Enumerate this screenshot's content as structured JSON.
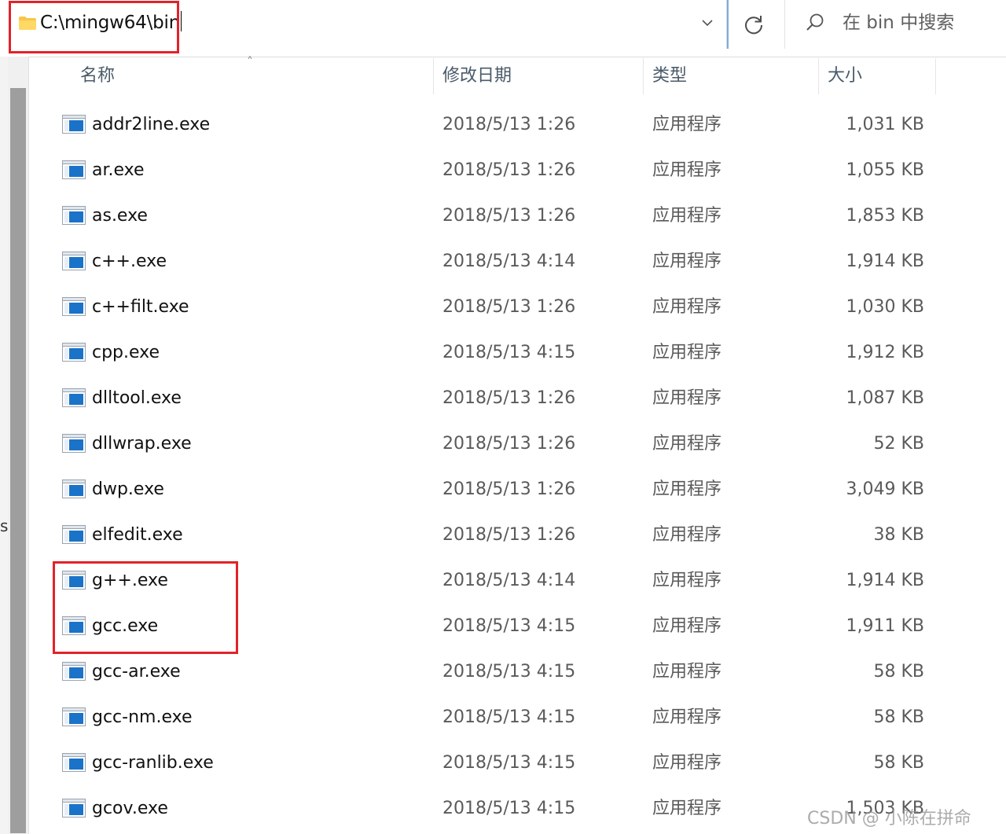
{
  "address_bar": {
    "path": "C:\\mingw64\\bin"
  },
  "search": {
    "placeholder": "在 bin 中搜索"
  },
  "columns": {
    "name": "名称",
    "modified": "修改日期",
    "type": "类型",
    "size": "大小"
  },
  "files": [
    {
      "name": "addr2line.exe",
      "modified": "2018/5/13 1:26",
      "type": "应用程序",
      "size": "1,031 KB"
    },
    {
      "name": "ar.exe",
      "modified": "2018/5/13 1:26",
      "type": "应用程序",
      "size": "1,055 KB"
    },
    {
      "name": "as.exe",
      "modified": "2018/5/13 1:26",
      "type": "应用程序",
      "size": "1,853 KB"
    },
    {
      "name": "c++.exe",
      "modified": "2018/5/13 4:14",
      "type": "应用程序",
      "size": "1,914 KB"
    },
    {
      "name": "c++filt.exe",
      "modified": "2018/5/13 1:26",
      "type": "应用程序",
      "size": "1,030 KB"
    },
    {
      "name": "cpp.exe",
      "modified": "2018/5/13 4:15",
      "type": "应用程序",
      "size": "1,912 KB"
    },
    {
      "name": "dlltool.exe",
      "modified": "2018/5/13 1:26",
      "type": "应用程序",
      "size": "1,087 KB"
    },
    {
      "name": "dllwrap.exe",
      "modified": "2018/5/13 1:26",
      "type": "应用程序",
      "size": "52 KB"
    },
    {
      "name": "dwp.exe",
      "modified": "2018/5/13 1:26",
      "type": "应用程序",
      "size": "3,049 KB"
    },
    {
      "name": "elfedit.exe",
      "modified": "2018/5/13 1:26",
      "type": "应用程序",
      "size": "38 KB"
    },
    {
      "name": "g++.exe",
      "modified": "2018/5/13 4:14",
      "type": "应用程序",
      "size": "1,914 KB"
    },
    {
      "name": "gcc.exe",
      "modified": "2018/5/13 4:15",
      "type": "应用程序",
      "size": "1,911 KB"
    },
    {
      "name": "gcc-ar.exe",
      "modified": "2018/5/13 4:15",
      "type": "应用程序",
      "size": "58 KB"
    },
    {
      "name": "gcc-nm.exe",
      "modified": "2018/5/13 4:15",
      "type": "应用程序",
      "size": "58 KB"
    },
    {
      "name": "gcc-ranlib.exe",
      "modified": "2018/5/13 4:15",
      "type": "应用程序",
      "size": "58 KB"
    },
    {
      "name": "gcov.exe",
      "modified": "2018/5/13 4:15",
      "type": "应用程序",
      "size": "1,503 KB"
    }
  ],
  "watermark": "CSDN @ 小陈在拼命",
  "colors": {
    "highlight_border": "#e2222a",
    "exe_icon_blue": "#1a73c8",
    "scrollbar_thumb": "#9e9e9e"
  }
}
